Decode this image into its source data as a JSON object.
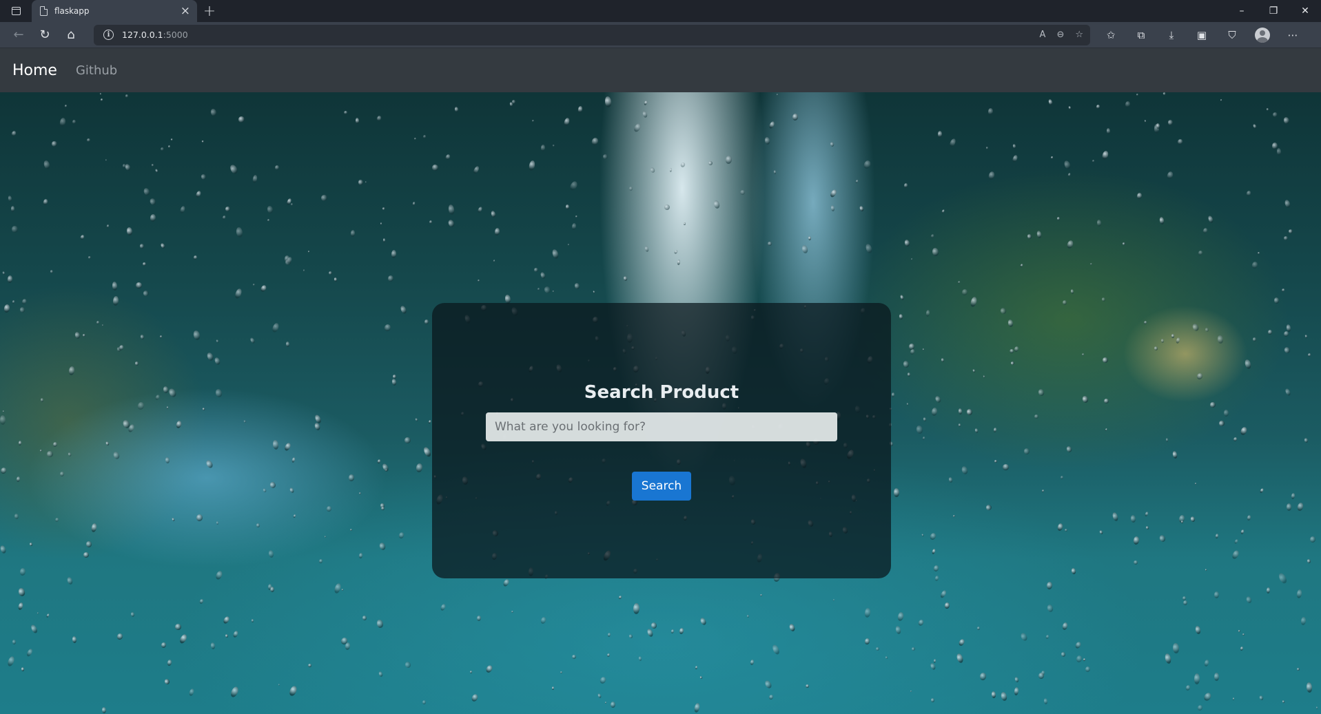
{
  "browser": {
    "tab_title": "flaskapp",
    "tab_close": "×",
    "new_tab": "+",
    "url_host": "127.0.0.1",
    "url_port": ":5000",
    "window_controls": {
      "minimize": "–",
      "restore": "❐",
      "close": "✕"
    },
    "nav": {
      "back": "←",
      "refresh": "↻",
      "home": "⌂"
    },
    "address_tools": {
      "read_aloud": "A",
      "zoom": "⊖",
      "add_favorite": "☆"
    },
    "toolbar_icons": [
      "favorites-icon",
      "collections-icon",
      "downloads-icon",
      "browser-essentials-icon",
      "shield-icon",
      "profile-icon",
      "more-icon"
    ],
    "toolbar_glyphs": {
      "favorites": "✩",
      "collections": "⧉",
      "downloads": "⤓",
      "essentials": "▣",
      "shield": "⛉",
      "more": "⋯"
    }
  },
  "navbar": {
    "brand": "Home",
    "links": [
      "Github"
    ],
    "bg_color": "#343a40"
  },
  "search_card": {
    "title": "Search Product",
    "input_placeholder": "What are you looking for?",
    "input_value": "",
    "button_label": "Search",
    "button_color": "#1976d2"
  }
}
